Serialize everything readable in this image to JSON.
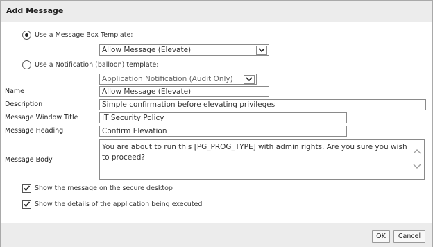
{
  "dialog": {
    "title": "Add Message"
  },
  "template_choice": {
    "message_box_label": "Use a Message Box Template:",
    "message_box_selected": "Allow Message (Elevate)",
    "notification_label": "Use a Notification (balloon) template:",
    "notification_selected": "Application Notification (Audit Only)"
  },
  "fields": {
    "name_label": "Name",
    "name_value": "Allow Message (Elevate)",
    "description_label": "Description",
    "description_value": "Simple confirmation before elevating privileges",
    "window_title_label": "Message Window Title",
    "window_title_value": "IT Security Policy",
    "heading_label": "Message Heading",
    "heading_value": "Confirm Elevation",
    "body_label": "Message Body",
    "body_value": "You are about to run this [PG_PROG_TYPE] with admin rights. Are you sure you wish to proceed?"
  },
  "options": {
    "secure_desktop_label": "Show the message on the secure desktop",
    "secure_desktop_checked": true,
    "show_details_label": "Show the details of the application being executed",
    "show_details_checked": true
  },
  "footer": {
    "ok_label": "OK",
    "cancel_label": "Cancel"
  }
}
